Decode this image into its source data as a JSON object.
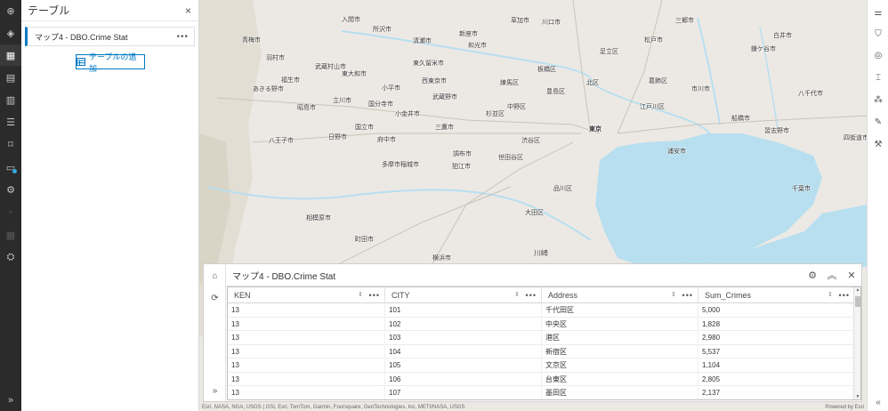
{
  "panel": {
    "title": "テーブル",
    "close_icon": "×",
    "item_label": "マップ4 - DBO.Crime Stat",
    "item_more": "•••",
    "add_button": "テーブルの追加"
  },
  "map": {
    "labels": [
      "入間市",
      "草加市",
      "三郷市",
      "所沢市",
      "川口市",
      "清瀬市",
      "新座市",
      "松戸市",
      "和光市",
      "足立区",
      "青梅市",
      "羽村市",
      "武蔵村山市",
      "東大和市",
      "東久留米市",
      "板橋区",
      "鎌ケ谷市",
      "白井市",
      "あきる野市",
      "福生市",
      "小平市",
      "西東京市",
      "練馬区",
      "北区",
      "葛飾区",
      "立川市",
      "武蔵野市",
      "豊島区",
      "市川市",
      "八千代市",
      "昭島市",
      "国分寺市",
      "小金井市",
      "中野区",
      "江戸川区",
      "船橋市",
      "八王子市",
      "日野市",
      "府中市",
      "三鷹市",
      "杉並区",
      "習志野市",
      "国立市",
      "渋谷区",
      "東京",
      "浦安市",
      "調布市",
      "世田谷区",
      "品川区",
      "四街道市",
      "多摩市",
      "稲城市",
      "狛江市",
      "千葉市",
      "相模原市",
      "町田市",
      "川崎",
      "大田区",
      "横浜市"
    ]
  },
  "attribution": "Esri, NASA, NGA, USGS | GSI, Esri, TomTom, Garmin, Foursquare, GeoTechnologies, Inc, METI/NASA, USGS",
  "powered_by": "Powered by Esri",
  "attr_table": {
    "title": "マップ4 - DBO.Crime Stat",
    "columns": [
      "KEN",
      "CITY",
      "Address",
      "Sum_Crimes"
    ],
    "rows": [
      [
        "13",
        "101",
        "千代田区",
        "5,000"
      ],
      [
        "13",
        "102",
        "中央区",
        "1,828"
      ],
      [
        "13",
        "103",
        "港区",
        "2,980"
      ],
      [
        "13",
        "104",
        "新宿区",
        "5,537"
      ],
      [
        "13",
        "105",
        "文京区",
        "1,104"
      ],
      [
        "13",
        "106",
        "台東区",
        "2,805"
      ],
      [
        "13",
        "107",
        "墨田区",
        "2,137"
      ]
    ]
  },
  "icons": {
    "left_toolbar": [
      "add-circle-icon",
      "layers-icon",
      "table-icon",
      "dashboard-icon",
      "chart-icon",
      "list-icon",
      "bookmark-icon",
      "data-table-icon",
      "settings-icon",
      "disabled-icon-1",
      "disabled-icon-2",
      "map-tools-icon"
    ],
    "right_toolbar": [
      "sliders-icon",
      "filter-icon",
      "sketch-icon",
      "measure-icon",
      "clusters-icon",
      "analysis-icon",
      "wrench-icon"
    ]
  },
  "colors": {
    "accent": "#0079c1",
    "water": "#b8dff0",
    "sidebar": "#2b2b2b"
  }
}
